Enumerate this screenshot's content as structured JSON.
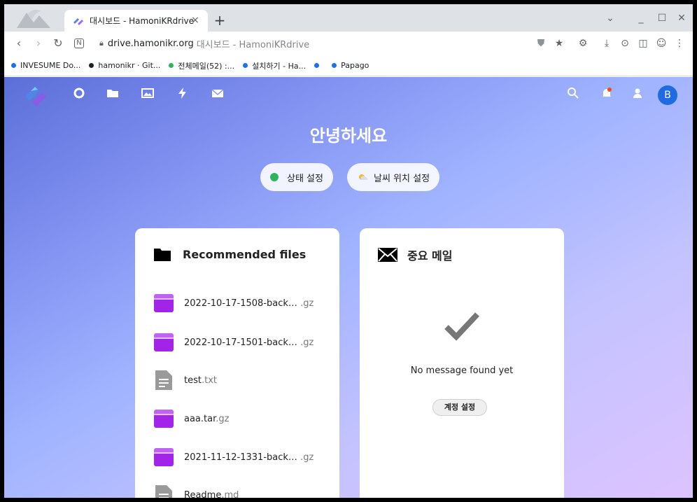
{
  "browser": {
    "tab_title": "대시보드 - HamoniKRdrive",
    "tab_close": "×",
    "new_tab": "+",
    "url_domain": "drive.hamonikr.org",
    "url_rest": "대시보드 - HamoniKRdrive",
    "bookmarks": [
      {
        "label": "INVESUME Do...",
        "color": "#1a73e8"
      },
      {
        "label": "hamonikr · Git...",
        "color": "#202124"
      },
      {
        "label": "전체메일(52) :...",
        "color": "#2eb45c"
      },
      {
        "label": "설치하기 - Ha...",
        "color": "#1a73e8"
      },
      {
        "label": "",
        "color": "#1a73e8"
      },
      {
        "label": "Papago",
        "color": "#1a73e8"
      }
    ]
  },
  "app": {
    "greeting": "안녕하세요",
    "status_button": "상태 설정",
    "weather_button": "날씨 위치 설정",
    "avatar_letter": "B",
    "files_card": {
      "title": "Recommended files",
      "files": [
        {
          "name": "2022-10-17-1508-back…",
          "ext": ".gz",
          "type": "archive"
        },
        {
          "name": "2022-10-17-1501-back…",
          "ext": ".gz",
          "type": "archive"
        },
        {
          "name": "test",
          "ext": ".txt",
          "type": "text"
        },
        {
          "name": "aaa.tar",
          "ext": ".gz",
          "type": "archive"
        },
        {
          "name": "2021-11-12-1331-back…",
          "ext": ".gz",
          "type": "archive"
        },
        {
          "name": "Readme",
          "ext": ".md",
          "type": "text"
        }
      ]
    },
    "mail_card": {
      "title": "중요 메일",
      "empty_message": "No message found yet",
      "account_button": "계정 설정"
    }
  }
}
